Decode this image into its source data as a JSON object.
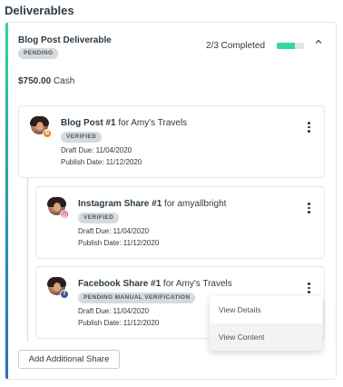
{
  "section": {
    "title": "Deliverables"
  },
  "deliverable": {
    "title": "Blog Post Deliverable",
    "status": "PENDING",
    "progress_text": "2/3 Completed",
    "progress_fraction": 0.667,
    "collapse_icon": "chevron-up-icon",
    "price_amount": "$750.00",
    "price_type": "Cash"
  },
  "posts": [
    {
      "title_bold": "Blog Post #1",
      "title_rest": " for Amy's Travels",
      "badge": "VERIFIED",
      "draft_due": "Draft Due: 11/04/2020",
      "publish_date": "Publish Date: 11/12/2020",
      "platform_icon": "blogger-icon"
    },
    {
      "title_bold": "Instagram Share #1",
      "title_rest": " for amyallbright",
      "badge": "VERIFIED",
      "draft_due": "Draft Due: 11/04/2020",
      "publish_date": "Publish Date: 11/12/2020",
      "platform_icon": "instagram-icon"
    },
    {
      "title_bold": "Facebook Share #1",
      "title_rest": " for Amy's Travels",
      "badge": "PENDING MANUAL VERIFICATION",
      "draft_due": "Draft Due: 11/04/2020",
      "publish_date": "Publish Date: 11/12/2020",
      "platform_icon": "facebook-icon"
    }
  ],
  "actions": {
    "add_share": "Add Additional Share"
  },
  "menu": {
    "items": [
      "View Details",
      "View Content"
    ]
  },
  "colors": {
    "accent": "#37d6a3",
    "badge_bg": "#d6dadd",
    "text": "#2d3b45"
  }
}
